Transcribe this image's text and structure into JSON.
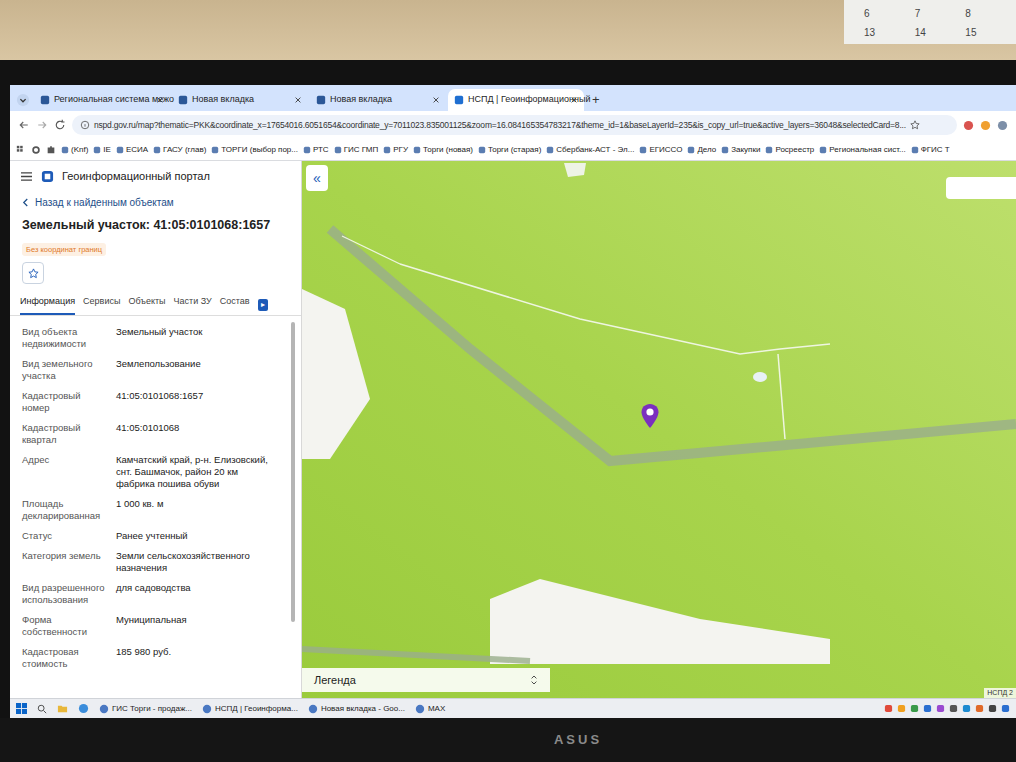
{
  "calendar": {
    "days": [
      "6",
      "7",
      "8",
      "13",
      "14",
      "15"
    ]
  },
  "browser": {
    "tabs": [
      {
        "label": "Региональная система межо",
        "selected": false
      },
      {
        "label": "Новая вкладка",
        "selected": false
      },
      {
        "label": "Новая вкладка",
        "selected": false
      },
      {
        "label": "НСПД | Геоинформационный",
        "selected": true
      }
    ],
    "new_tab": "+",
    "url": "nspd.gov.ru/map?thematic=PKK&coordinate_x=17654016.6051654&coordinate_y=7011023.835001125&zoom=16.084165354783217&theme_id=1&baseLayerId=235&is_copy_url=true&active_layers=36048&selectedCard=8...",
    "bookmarks": [
      "(Knf)",
      "IE",
      "ЕСИА",
      "ГАСУ (глав)",
      "ТОРГИ (выбор пор...",
      "РТС",
      "ГИС ГМП",
      "РГУ",
      "Торги (новая)",
      "Торги (старая)",
      "Сбербанк-АСТ - Эл...",
      "ЕГИССО",
      "Дело",
      "Закупки",
      "Росреестр",
      "Региональная сист...",
      "ФГИС Т"
    ]
  },
  "panel": {
    "title": "Геоинформационный портал",
    "back": "Назад к найденным объектам",
    "heading": "Земельный участок: 41:05:0101068:1657",
    "badge": "Без координат границ",
    "tabs": [
      {
        "label": "Информация",
        "selected": true
      },
      {
        "label": "Сервисы",
        "selected": false
      },
      {
        "label": "Объекты",
        "selected": false
      },
      {
        "label": "Части ЗУ",
        "selected": false
      },
      {
        "label": "Состав",
        "selected": false
      }
    ],
    "more": "▸",
    "fields": [
      {
        "label": "Вид объекта недвижимости",
        "value": "Земельный участок"
      },
      {
        "label": "Вид земельного участка",
        "value": "Землепользование"
      },
      {
        "label": "Кадастровый номер",
        "value": "41:05:0101068:1657"
      },
      {
        "label": "Кадастровый квартал",
        "value": "41:05:0101068"
      },
      {
        "label": "Адрес",
        "value": "Камчатский край, р-н. Елизовский, снт. Башмачок, район 20 км фабрика пошива обуви"
      },
      {
        "label": "Площадь декларированная",
        "value": "1 000 кв. м"
      },
      {
        "label": "Статус",
        "value": "Ранее учтенный"
      },
      {
        "label": "Категория земель",
        "value": "Земли сельскохозяйственного назначения"
      },
      {
        "label": "Вид разрешенного использования",
        "value": "для садоводства"
      },
      {
        "label": "Форма собственности",
        "value": "Муниципальная"
      },
      {
        "label": "Кадастровая стоимость",
        "value": "185 980 руб."
      }
    ]
  },
  "map": {
    "collapse": "«",
    "legend": "Легенда",
    "attribution": "НСПД 2"
  },
  "taskbar": {
    "items": [
      "ГИС Торги - продаж...",
      "НСПД | Геоинформа...",
      "Новая вкладка - Goo...",
      "MAX"
    ]
  },
  "monitor": {
    "brand": "ASUS"
  }
}
